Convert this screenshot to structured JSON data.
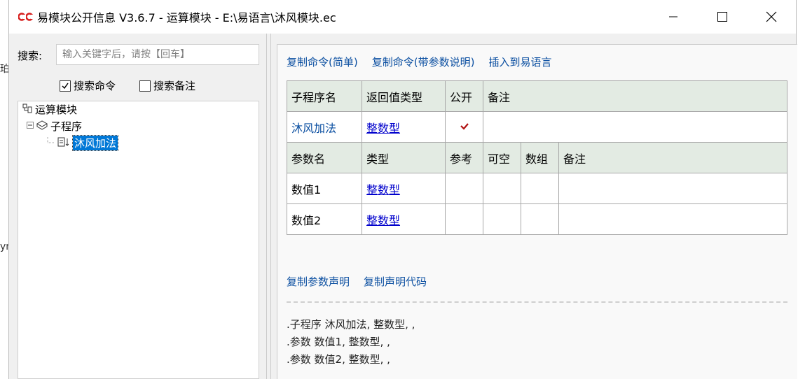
{
  "window": {
    "title": "易模块公开信息 V3.6.7 - 运算模块 - E:\\易语言\\沐风模块.ec",
    "icon_text": "𝕮𝕮"
  },
  "background": {
    "frag1": "珀",
    "frag2": "yn"
  },
  "search": {
    "label": "搜索:",
    "placeholder": "输入关键字后，请按【回车】",
    "value": "",
    "opt_commands_label": "搜索命令",
    "opt_commands_checked": true,
    "opt_notes_label": "搜索备注",
    "opt_notes_checked": false
  },
  "tree": {
    "root": "运算模块",
    "child": "子程序",
    "leaf": "沐风加法"
  },
  "actions": {
    "copy_simple": "复制命令(简单)",
    "copy_detailed": "复制命令(带参数说明)",
    "insert": "插入到易语言",
    "copy_param_decl": "复制参数声明",
    "copy_decl_code": "复制声明代码"
  },
  "sub_table": {
    "headers": [
      "子程序名",
      "返回值类型",
      "公开",
      "备注"
    ],
    "row": {
      "name": "沐风加法",
      "return_type": "整数型",
      "public": true,
      "note": ""
    }
  },
  "param_table": {
    "headers": [
      "参数名",
      "类型",
      "参考",
      "可空",
      "数组",
      "备注"
    ],
    "rows": [
      {
        "name": "数值1",
        "type": "整数型"
      },
      {
        "name": "数值2",
        "type": "整数型"
      }
    ]
  },
  "code": {
    "line1": ".子程序 沐风加法, 整数型, ,",
    "line2": ".参数 数值1, 整数型, ,",
    "line3": ".参数 数值2, 整数型, ,"
  }
}
